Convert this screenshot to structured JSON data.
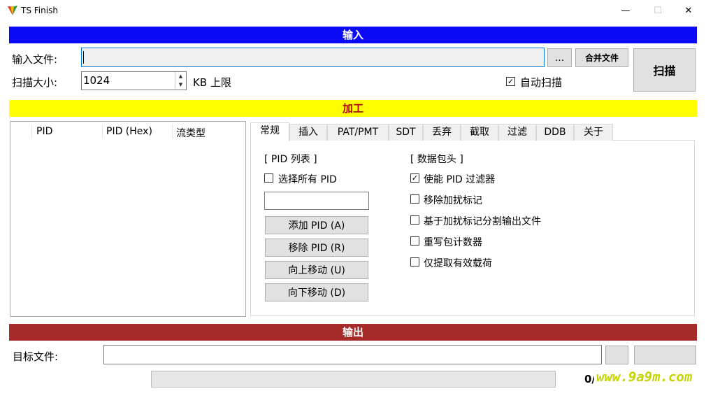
{
  "window": {
    "title": "TS Finish",
    "min_glyph": "—",
    "max_glyph": "☐",
    "close_glyph": "✕"
  },
  "sections": {
    "input": "输入",
    "process": "加工",
    "output": "输出"
  },
  "input": {
    "file_label": "输入文件:",
    "file_value": "",
    "browse_label": "...",
    "merge_label": "合并文件",
    "scan_label": "扫描",
    "scan_size_label": "扫描大小:",
    "scan_size_value": "1024",
    "limit_label": "KB 上限",
    "auto_scan_label": "自动扫描",
    "auto_scan_checked": true
  },
  "pid_list": {
    "columns": [
      "PID",
      "PID (Hex)",
      "流类型"
    ]
  },
  "tabs": [
    {
      "label": "常规",
      "active": true
    },
    {
      "label": "插入"
    },
    {
      "label": "PAT/PMT"
    },
    {
      "label": "SDT"
    },
    {
      "label": "丢弃"
    },
    {
      "label": "截取"
    },
    {
      "label": "过滤"
    },
    {
      "label": "DDB"
    },
    {
      "label": "关于"
    }
  ],
  "general_tab": {
    "pid_group_label": "[ PID 列表 ]",
    "select_all_label": "选择所有 PID",
    "select_all_checked": false,
    "pid_entry_value": "",
    "add_pid": "添加 PID (A)",
    "remove_pid": "移除 PID (R)",
    "move_up": "向上移动 (U)",
    "move_down": "向下移动 (D)",
    "header_group_label": "[ 数据包头 ]",
    "options": [
      {
        "label": "使能 PID 过滤器",
        "checked": true
      },
      {
        "label": "移除加扰标记",
        "checked": false
      },
      {
        "label": "基于加扰标记分割输出文件",
        "checked": false
      },
      {
        "label": "重写包计数器",
        "checked": false
      },
      {
        "label": "仅提取有效载荷",
        "checked": false
      }
    ]
  },
  "output": {
    "target_label": "目标文件:",
    "target_value": "",
    "progress_text": "0/",
    "progress_value": 0
  },
  "watermark": "www.9a9m.com",
  "check_glyph": "✓",
  "spin_up_glyph": "▲",
  "spin_down_glyph": "▼"
}
